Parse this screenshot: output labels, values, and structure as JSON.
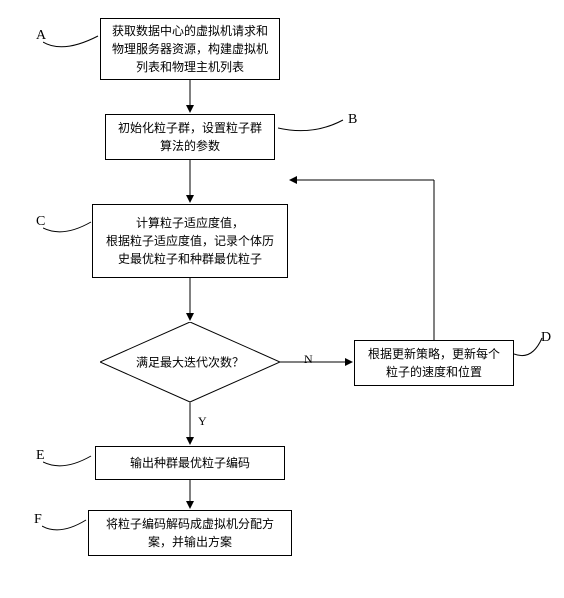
{
  "labels": {
    "A": "A",
    "B": "B",
    "C": "C",
    "D": "D",
    "E": "E",
    "F": "F",
    "Y": "Y",
    "N": "N"
  },
  "boxes": {
    "A": "获取数据中心的虚拟机请求和物理服务器资源，构建虚拟机列表和物理主机列表",
    "B": "初始化粒子群，设置粒子群算法的参数",
    "C": "计算粒子适应度值，\n根据粒子适应度值，记录个体历史最优粒子和种群最优粒子",
    "D": "根据更新策略，更新每个粒子的速度和位置",
    "E": "输出种群最优粒子编码",
    "F": "将粒子编码解码成虚拟机分配方案，并输出方案"
  },
  "decision": "满足最大迭代次数？",
  "chart_data": {
    "type": "flowchart",
    "nodes": [
      {
        "id": "A",
        "type": "process",
        "text": "获取数据中心的虚拟机请求和物理服务器资源，构建虚拟机列表和物理主机列表"
      },
      {
        "id": "B",
        "type": "process",
        "text": "初始化粒子群，设置粒子群算法的参数"
      },
      {
        "id": "C",
        "type": "process",
        "text": "计算粒子适应度值，根据粒子适应度值，记录个体历史最优粒子和种群最优粒子"
      },
      {
        "id": "DEC",
        "type": "decision",
        "text": "满足最大迭代次数？"
      },
      {
        "id": "D",
        "type": "process",
        "text": "根据更新策略，更新每个粒子的速度和位置"
      },
      {
        "id": "E",
        "type": "process",
        "text": "输出种群最优粒子编码"
      },
      {
        "id": "F",
        "type": "process",
        "text": "将粒子编码解码成虚拟机分配方案，并输出方案"
      }
    ],
    "edges": [
      {
        "from": "A",
        "to": "B"
      },
      {
        "from": "B",
        "to": "C"
      },
      {
        "from": "C",
        "to": "DEC"
      },
      {
        "from": "DEC",
        "to": "D",
        "label": "N"
      },
      {
        "from": "D",
        "to": "C"
      },
      {
        "from": "DEC",
        "to": "E",
        "label": "Y"
      },
      {
        "from": "E",
        "to": "F"
      }
    ]
  }
}
